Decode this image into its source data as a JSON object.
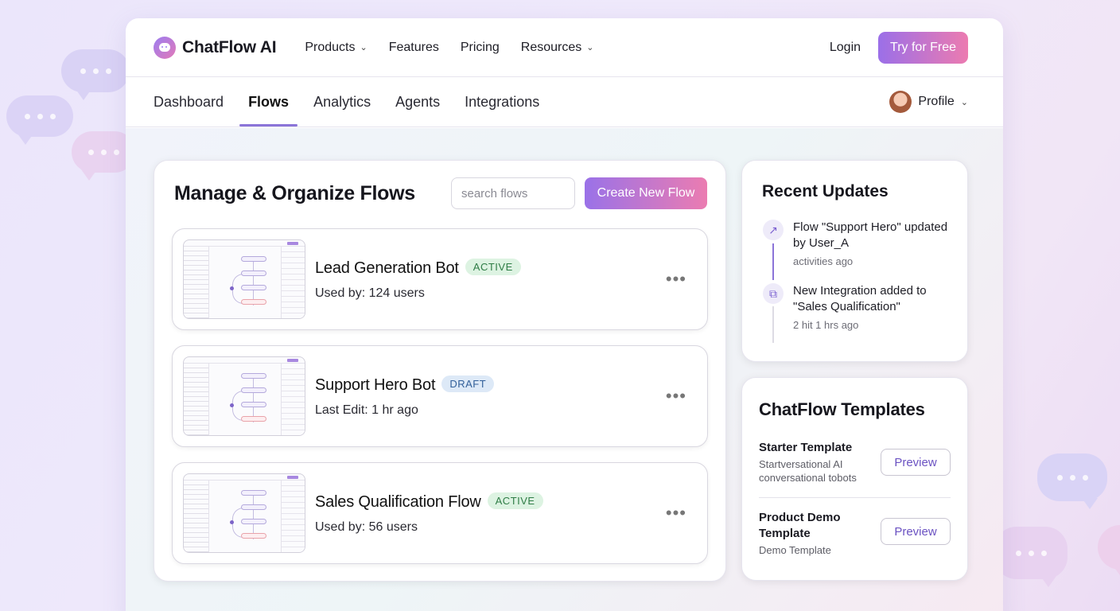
{
  "app": {
    "name": "ChatFlow AI"
  },
  "topnav": {
    "items": [
      {
        "label": "Products",
        "dropdown": true
      },
      {
        "label": "Features",
        "dropdown": false
      },
      {
        "label": "Pricing",
        "dropdown": false
      },
      {
        "label": "Resources",
        "dropdown": true
      }
    ],
    "login": "Login",
    "cta": "Try for Free"
  },
  "subnav": {
    "tabs": [
      "Dashboard",
      "Flows",
      "Analytics",
      "Agents",
      "Integrations"
    ],
    "active": "Flows",
    "profile": "Profile"
  },
  "flows": {
    "title": "Manage & Organize Flows",
    "search_placeholder": "search flows",
    "create_label": "Create New Flow",
    "items": [
      {
        "name": "Lead Generation Bot",
        "status": "ACTIVE",
        "meta": "Used by: 124 users"
      },
      {
        "name": "Support Hero Bot",
        "status": "DRAFT",
        "meta": "Last Edit: 1 hr ago"
      },
      {
        "name": "Sales Qualification Flow",
        "status": "ACTIVE",
        "meta": "Used by: 56 users"
      }
    ],
    "more_label": "•••"
  },
  "updates": {
    "title": "Recent Updates",
    "items": [
      {
        "text": "Flow \"Support Hero\" updated by User_A",
        "time": "activities ago",
        "icon": "arrow-up-right-icon"
      },
      {
        "text": "New Integration added to \"Sales Qualification\"",
        "time": "2 hit 1 hrs ago",
        "icon": "integration-icon"
      }
    ]
  },
  "templates": {
    "title": "ChatFlow Templates",
    "items": [
      {
        "name": "Starter Template",
        "desc": "Startversational AI conversational tobots",
        "button": "Preview"
      },
      {
        "name": "Product Demo Template",
        "desc": "Demo Template",
        "button": "Preview"
      }
    ]
  },
  "colors": {
    "accent_start": "#9b6fe8",
    "accent_end": "#ec7bb0",
    "active_badge": "#ddf3e2",
    "draft_badge": "#dde9f7"
  }
}
